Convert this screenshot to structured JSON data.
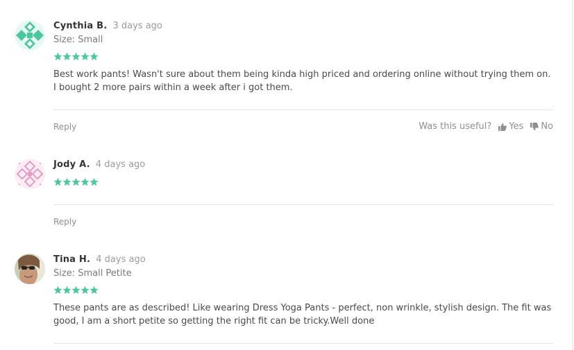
{
  "colors": {
    "star": "#4dc7a0",
    "accent": "#4dc7a0"
  },
  "reviews": [
    {
      "author": "Cynthia B.",
      "date": "3 days ago",
      "size": "Size: Small",
      "rating": 5,
      "text": "Best work pants! Wasn't sure about them being kinda high priced and ordering online without trying them on. I bought 2 more pairs within a week after i got them.",
      "reply_label": "Reply",
      "useful_label": "Was this useful?",
      "yes_label": "Yes",
      "no_label": "No",
      "avatar_icon": "teal-quilt-pattern-icon"
    },
    {
      "author": "Jody A.",
      "date": "4 days ago",
      "rating": 5,
      "reply_label": "Reply",
      "avatar_icon": "pink-quilt-pattern-icon"
    },
    {
      "author": "Tina H.",
      "date": "4 days ago",
      "size": "Size: Small Petite",
      "rating": 5,
      "text": "These pants are as described! Like wearing Dress Yoga Pants - perfect, non wrinkle, stylish design. The fit was good, I am a short petite so getting the right fit can be tricky.Well done",
      "avatar_icon": "user-photo-avatar"
    }
  ]
}
